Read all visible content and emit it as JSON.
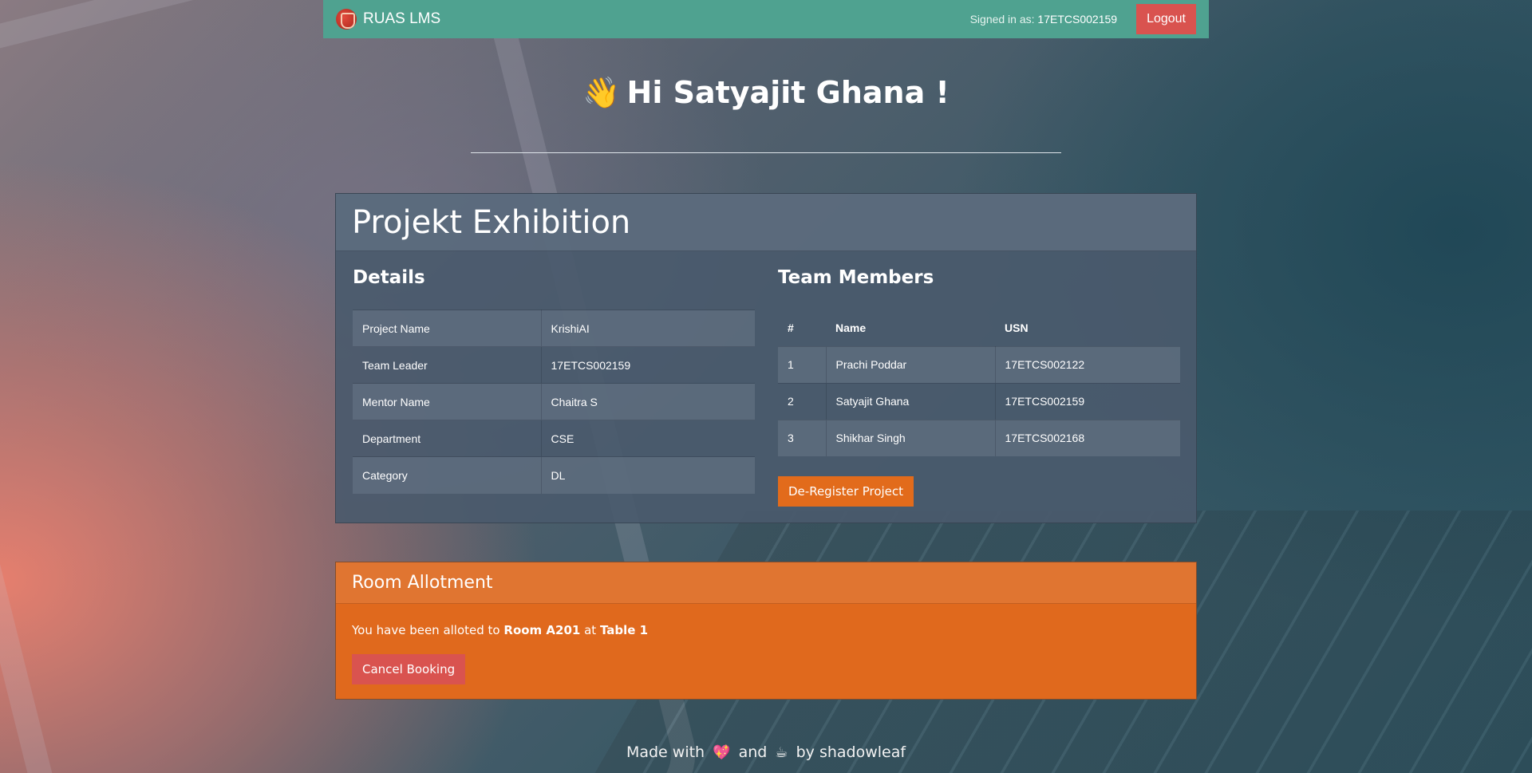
{
  "navbar": {
    "brand": "RUAS LMS",
    "signed_in_label": "Signed in as:",
    "signed_in_usn": "17ETCS002159",
    "logout_label": "Logout"
  },
  "greeting": {
    "emoji": "👋",
    "text": "Hi Satyajit Ghana !"
  },
  "project_card": {
    "title": "Projekt Exhibition",
    "details_title": "Details",
    "details": [
      {
        "label": "Project Name",
        "value": "KrishiAI"
      },
      {
        "label": "Team Leader",
        "value": "17ETCS002159"
      },
      {
        "label": "Mentor Name",
        "value": "Chaitra S"
      },
      {
        "label": "Department",
        "value": "CSE"
      },
      {
        "label": "Category",
        "value": "DL"
      }
    ],
    "team_title": "Team Members",
    "team_columns": [
      "#",
      "Name",
      "USN"
    ],
    "team": [
      {
        "num": "1",
        "name": "Prachi Poddar",
        "usn": "17ETCS002122"
      },
      {
        "num": "2",
        "name": "Satyajit Ghana",
        "usn": "17ETCS002159"
      },
      {
        "num": "3",
        "name": "Shikhar Singh",
        "usn": "17ETCS002168"
      }
    ],
    "deregister_label": "De-Register Project"
  },
  "room_card": {
    "title": "Room Allotment",
    "text_prefix": "You have been alloted to ",
    "room": "Room A201",
    "text_mid": " at ",
    "table": "Table 1",
    "cancel_label": "Cancel Booking"
  },
  "footer": {
    "made_with": "Made with",
    "heart_emoji": "💖",
    "and": "and",
    "coffee_emoji": "☕",
    "by": "by shadowleaf"
  },
  "colors": {
    "navbar": "#4fa290",
    "logout": "#d9534f",
    "deregister": "#e26b1b",
    "room_card": "#e0691d"
  }
}
